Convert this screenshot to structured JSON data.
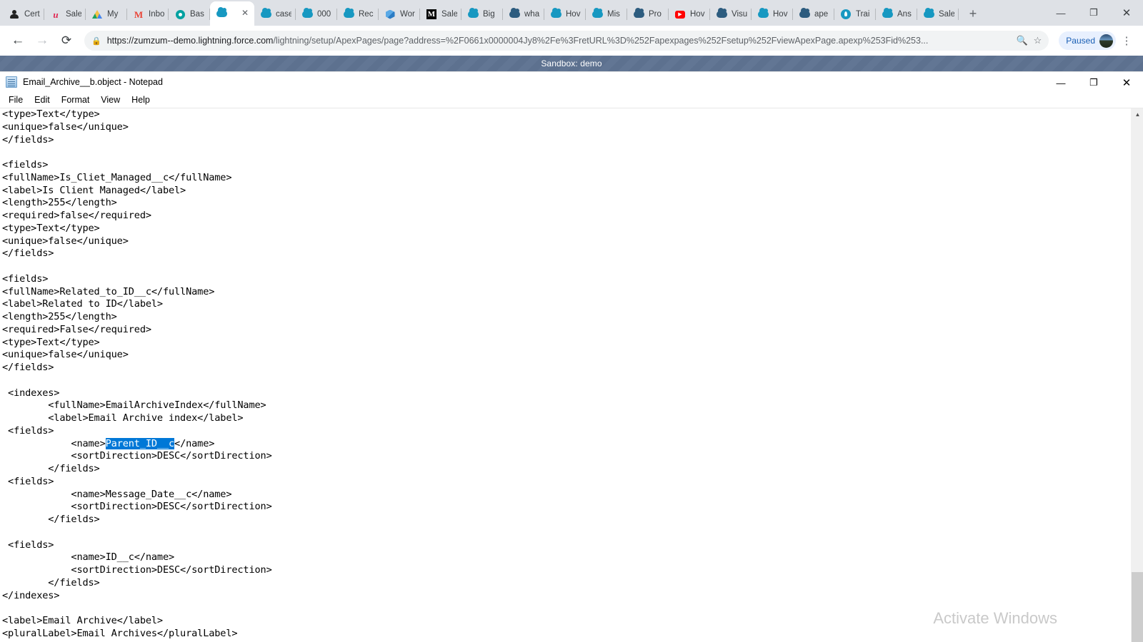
{
  "browser": {
    "tabs": [
      {
        "label": "Cert",
        "icon": "person-icon",
        "icon_kind": "person",
        "active": false
      },
      {
        "label": "Sale",
        "icon": "u-letter-icon",
        "icon_kind": "u-red",
        "active": false
      },
      {
        "label": "My",
        "icon": "drive-icon",
        "icon_kind": "drive",
        "active": false
      },
      {
        "label": "Inbo",
        "icon": "gmail-icon",
        "icon_kind": "m-red",
        "active": false
      },
      {
        "label": "Bas",
        "icon": "pin-icon",
        "icon_kind": "pin",
        "active": false
      },
      {
        "label": "",
        "icon": "salesforce-cloud-icon",
        "icon_kind": "cloud",
        "active": true
      },
      {
        "label": "case",
        "icon": "salesforce-cloud-icon",
        "icon_kind": "cloud",
        "active": false
      },
      {
        "label": "000",
        "icon": "salesforce-cloud-icon",
        "icon_kind": "cloud",
        "active": false
      },
      {
        "label": "Rec",
        "icon": "salesforce-cloud-icon",
        "icon_kind": "cloud",
        "active": false
      },
      {
        "label": "Wor",
        "icon": "cube-icon",
        "icon_kind": "cube",
        "active": false
      },
      {
        "label": "Sale",
        "icon": "medium-icon",
        "icon_kind": "box-m",
        "active": false
      },
      {
        "label": "Big",
        "icon": "salesforce-cloud-icon",
        "icon_kind": "cloud",
        "active": false
      },
      {
        "label": "wha",
        "icon": "dark-cloud-icon",
        "icon_kind": "darkcloud",
        "active": false
      },
      {
        "label": "Hov",
        "icon": "salesforce-cloud-icon",
        "icon_kind": "cloud",
        "active": false
      },
      {
        "label": "Mis",
        "icon": "salesforce-cloud-icon",
        "icon_kind": "cloud",
        "active": false
      },
      {
        "label": "Pro",
        "icon": "dark-cloud-icon",
        "icon_kind": "darkcloud",
        "active": false
      },
      {
        "label": "Hov",
        "icon": "youtube-icon",
        "icon_kind": "yt",
        "active": false
      },
      {
        "label": "Visu",
        "icon": "dark-cloud-icon",
        "icon_kind": "darkcloud",
        "active": false
      },
      {
        "label": "Hov",
        "icon": "salesforce-cloud-icon",
        "icon_kind": "cloud",
        "active": false
      },
      {
        "label": "ape",
        "icon": "dark-cloud-icon",
        "icon_kind": "darkcloud",
        "active": false
      },
      {
        "label": "Trai",
        "icon": "trailhead-icon",
        "icon_kind": "drop",
        "active": false
      },
      {
        "label": "Ans",
        "icon": "salesforce-cloud-icon",
        "icon_kind": "cloud",
        "active": false
      },
      {
        "label": "Sale",
        "icon": "salesforce-cloud-icon",
        "icon_kind": "cloud",
        "active": false
      }
    ],
    "new_tab_label": "+",
    "window_controls": {
      "minimize": "—",
      "maximize": "❐",
      "close": "✕"
    },
    "nav": {
      "back": "←",
      "forward": "→",
      "reload": "⟳"
    },
    "omnibox": {
      "lock_icon": "lock-icon",
      "url_prefix": "https://zumzum--demo.lightning.force.com",
      "url_rest": "/lightning/setup/ApexPages/page?address=%2F0661x0000004Jy8%2Fe%3FretURL%3D%252Fapexpages%252Fsetup%252FviewApexPage.apexp%253Fid%253...",
      "zoom_icon": "search-icon",
      "bookmark_icon": "star-icon"
    },
    "profile": {
      "label": "Paused",
      "avatar": "avatar-image"
    },
    "menu_icon": "kebab-menu-icon"
  },
  "sandbox_banner": {
    "text": "Sandbox: demo"
  },
  "notepad": {
    "icon": "notepad-icon",
    "title": "Email_Archive__b.object - Notepad",
    "window_controls": {
      "minimize": "—",
      "maximize": "❐",
      "close": "✕"
    },
    "menus": [
      "File",
      "Edit",
      "Format",
      "View",
      "Help"
    ],
    "scrollbar": {
      "up_arrow": "▲",
      "down_arrow": "▼"
    },
    "content_before_selection": "<type>Text</type>\n<unique>false</unique>\n</fields>\n\n<fields>\n<fullName>Is_Cliet_Managed__c</fullName>\n<label>Is Client Managed</label>\n<length>255</length>\n<required>false</required>\n<type>Text</type>\n<unique>false</unique>\n</fields>\n\n<fields>\n<fullName>Related_to_ID__c</fullName>\n<label>Related to ID</label>\n<length>255</length>\n<required>False</required>\n<type>Text</type>\n<unique>false</unique>\n</fields>\n\n <indexes>\n        <fullName>EmailArchiveIndex</fullName>\n        <label>Email Archive index</label>\n <fields>\n            <name>",
    "selected_text": "Parent_ID__c",
    "content_after_selection": "</name>\n            <sortDirection>DESC</sortDirection>\n        </fields>\n <fields>\n            <name>Message_Date__c</name>\n            <sortDirection>DESC</sortDirection>\n        </fields>\n\n <fields>\n            <name>ID__c</name>\n            <sortDirection>DESC</sortDirection>\n        </fields>\n</indexes>\n\n<label>Email Archive</label>\n<pluralLabel>Email Archives</pluralLabel>"
  },
  "watermark": {
    "text": "Activate Windows"
  }
}
